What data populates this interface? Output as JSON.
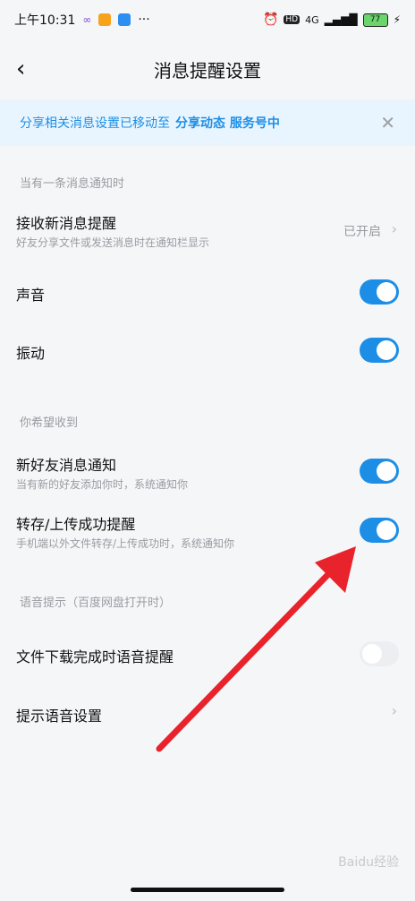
{
  "status_bar": {
    "time": "上午10:31",
    "network": "4G",
    "battery": "77"
  },
  "header": {
    "title": "消息提醒设置"
  },
  "banner": {
    "text": "分享相关消息设置已移动至",
    "link": "分享动态 服务号中"
  },
  "sections": [
    {
      "label": "当有一条消息通知时"
    },
    {
      "label": "你希望收到"
    },
    {
      "label": "语音提示（百度网盘打开时）"
    }
  ],
  "rows": {
    "receive_new": {
      "title": "接收新消息提醒",
      "subtitle": "好友分享文件或发送消息时在通知栏显示",
      "status": "已开启"
    },
    "sound": {
      "title": "声音",
      "enabled": true
    },
    "vibrate": {
      "title": "振动",
      "enabled": true
    },
    "new_friend": {
      "title": "新好友消息通知",
      "subtitle": "当有新的好友添加你时，系统通知你",
      "enabled": true
    },
    "transfer_upload": {
      "title": "转存/上传成功提醒",
      "subtitle": "手机端以外文件转存/上传成功时，系统通知你",
      "enabled": true
    },
    "download_voice": {
      "title": "文件下载完成时语音提醒",
      "enabled": false
    },
    "voice_settings": {
      "title": "提示语音设置"
    }
  },
  "watermark": "Baidu经验",
  "colors": {
    "accent": "#1d8ee6",
    "arrow": "#e8232b"
  }
}
